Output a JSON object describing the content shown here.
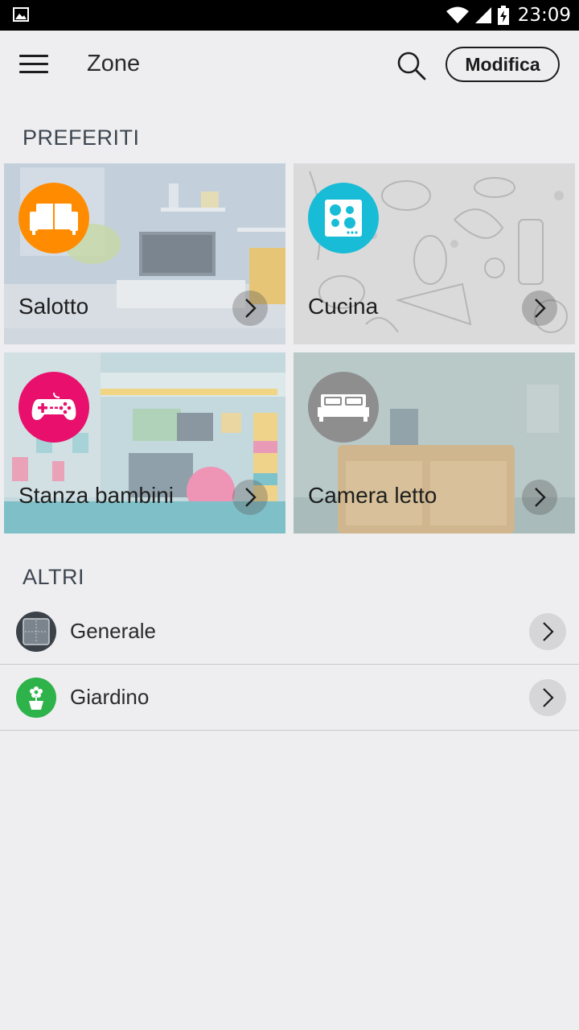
{
  "status_bar": {
    "time": "23:09"
  },
  "header": {
    "title": "Zone",
    "edit_label": "Modifica"
  },
  "sections": {
    "favorites": "PREFERITI",
    "others": "ALTRI"
  },
  "favorites": [
    {
      "label": "Salotto",
      "icon": "sofa-icon",
      "badge_color": "#ff8c00"
    },
    {
      "label": "Cucina",
      "icon": "cooktop-icon",
      "badge_color": "#18bcd6"
    },
    {
      "label": "Stanza bambini",
      "icon": "gamepad-icon",
      "badge_color": "#e8106c"
    },
    {
      "label": "Camera letto",
      "icon": "bed-icon",
      "badge_color": "#8e8e8e"
    }
  ],
  "others": [
    {
      "label": "Generale",
      "icon": "grid-icon",
      "icon_color": "#3b424a"
    },
    {
      "label": "Giardino",
      "icon": "flower-pot-icon",
      "icon_color": "#2eb24a"
    }
  ]
}
